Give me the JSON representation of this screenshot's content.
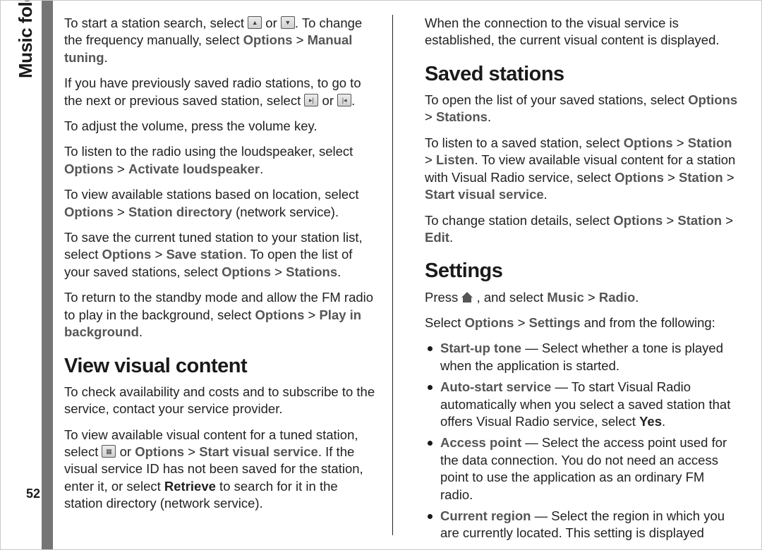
{
  "section_label": "Music folder",
  "page_number": "52",
  "left": {
    "p1_a": "To start a station search, select ",
    "p1_mid": " or ",
    "p1_b": ". To change the frequency manually, select ",
    "p1_menu1": "Options",
    "p1_gt": "  > ",
    "p1_menu2": "Manual tuning",
    "p1_end": ".",
    "p2_a": "If you have previously saved radio stations, to go to the next or previous saved station, select ",
    "p2_mid": " or ",
    "p2_end": ".",
    "p3": "To adjust the volume, press the volume key.",
    "p4_a": "To listen to the radio using the loudspeaker, select ",
    "p4_m1": "Options",
    "p4_gt": "  >  ",
    "p4_m2": "Activate loudspeaker",
    "p4_end": ".",
    "p5_a": "To view available stations based on location, select ",
    "p5_m1": "Options",
    "p5_gt": "  >  ",
    "p5_m2": "Station directory",
    "p5_b": " (network service).",
    "p6_a": "To save the current tuned station to your station list, select ",
    "p6_m1": "Options",
    "p6_gt": "  >  ",
    "p6_m2": "Save station",
    "p6_b": ". To open the list of your saved stations, select ",
    "p6_m3": "Options",
    "p6_gt2": "  >  ",
    "p6_m4": "Stations",
    "p6_end": ".",
    "p7_a": "To return to the standby mode and allow the FM radio to play in the background, select ",
    "p7_m1": "Options",
    "p7_gt": "  > ",
    "p7_m2": "Play in background",
    "p7_end": ".",
    "h1": "View visual content",
    "p8": "To check availability and costs and to subscribe to the service, contact your service provider.",
    "p9_a": "To view available visual content for a tuned station, select ",
    "p9_mid": " or ",
    "p9_m1": "Options",
    "p9_gt": "  >  ",
    "p9_m2": "Start visual service",
    "p9_b": ". If the visual service ID has not been saved for the station, enter it, or select ",
    "p9_m3": "Retrieve",
    "p9_c": " to search for it in the station directory (network service)."
  },
  "right": {
    "p1": "When the connection to the visual service is established, the current visual content is displayed.",
    "h1": "Saved stations",
    "p2_a": "To open the list of your saved stations, select ",
    "p2_m1": "Options",
    "p2_gt": "  >  ",
    "p2_m2": "Stations",
    "p2_end": ".",
    "p3_a": "To listen to a saved station, select ",
    "p3_m1": "Options",
    "p3_gt": "  > ",
    "p3_m2": "Station",
    "p3_gt2": "  >  ",
    "p3_m3": "Listen",
    "p3_b": ". To view available visual content for a station with Visual Radio service, select ",
    "p3_m4": "Options",
    "p3_gt3": "  >  ",
    "p3_m5": "Station",
    "p3_gt4": "  >  ",
    "p3_m6": "Start visual service",
    "p3_end": ".",
    "p4_a": "To change station details, select ",
    "p4_m1": "Options",
    "p4_gt": "  > ",
    "p4_m2": "Station",
    "p4_gt2": "  >  ",
    "p4_m3": "Edit",
    "p4_end": ".",
    "h2": "Settings",
    "p5_a": "Press ",
    "p5_b": " , and select ",
    "p5_m1": "Music",
    "p5_gt": "  >  ",
    "p5_m2": "Radio",
    "p5_end": ".",
    "p6_a": "Select ",
    "p6_m1": "Options",
    "p6_gt": "  >  ",
    "p6_m2": "Settings",
    "p6_b": " and from the following:",
    "items": [
      {
        "name": "Start-up tone",
        "text": " — Select whether a tone is played when the application is started."
      },
      {
        "name": "Auto-start service",
        "text": " — To start Visual Radio automatically when you select a saved station that offers Visual Radio service, select ",
        "bold": "Yes",
        "text2": "."
      },
      {
        "name": "Access point",
        "text": " — Select the access point used for the data connection. You do not need an access point to use the application as an ordinary FM radio."
      },
      {
        "name": "Current region",
        "text": " — Select the region in which you are currently located. This setting is displayed"
      }
    ]
  }
}
